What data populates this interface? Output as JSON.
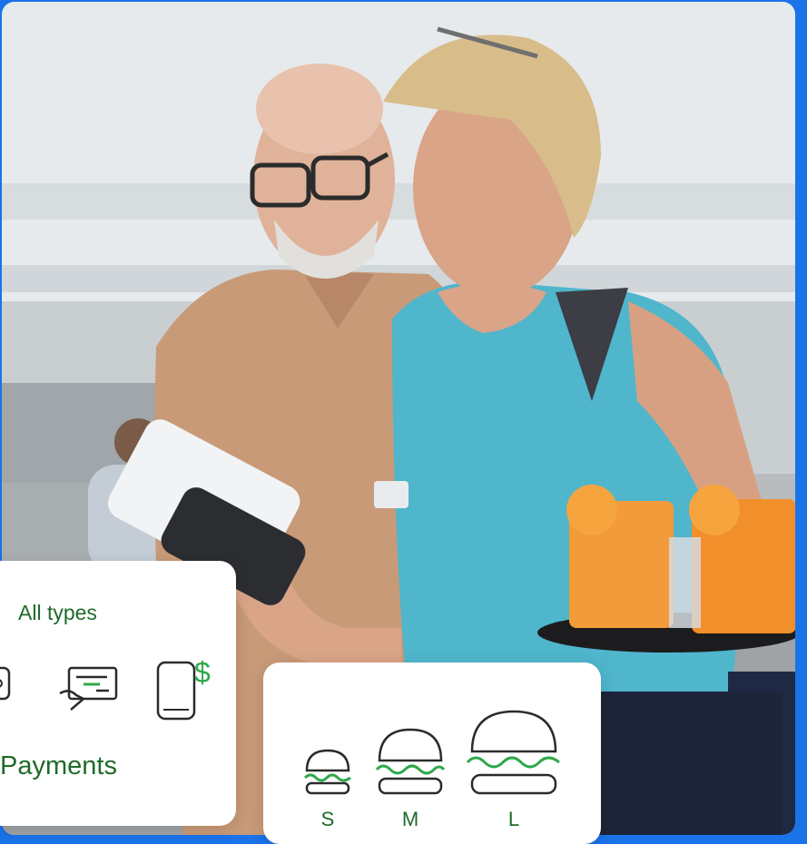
{
  "payments_card": {
    "title": "All types",
    "label": "Payments",
    "icons": [
      "card-reader-icon",
      "check-icon",
      "mobile-payment-icon"
    ]
  },
  "sizes_card": {
    "sizes": [
      "S",
      "M",
      "L"
    ],
    "icons": [
      "burger-small-icon",
      "burger-medium-icon",
      "burger-large-icon"
    ]
  },
  "colors": {
    "frame_blue": "#1a73e8",
    "brand_green": "#1f6b2a",
    "accent_green": "#2ea84a"
  }
}
